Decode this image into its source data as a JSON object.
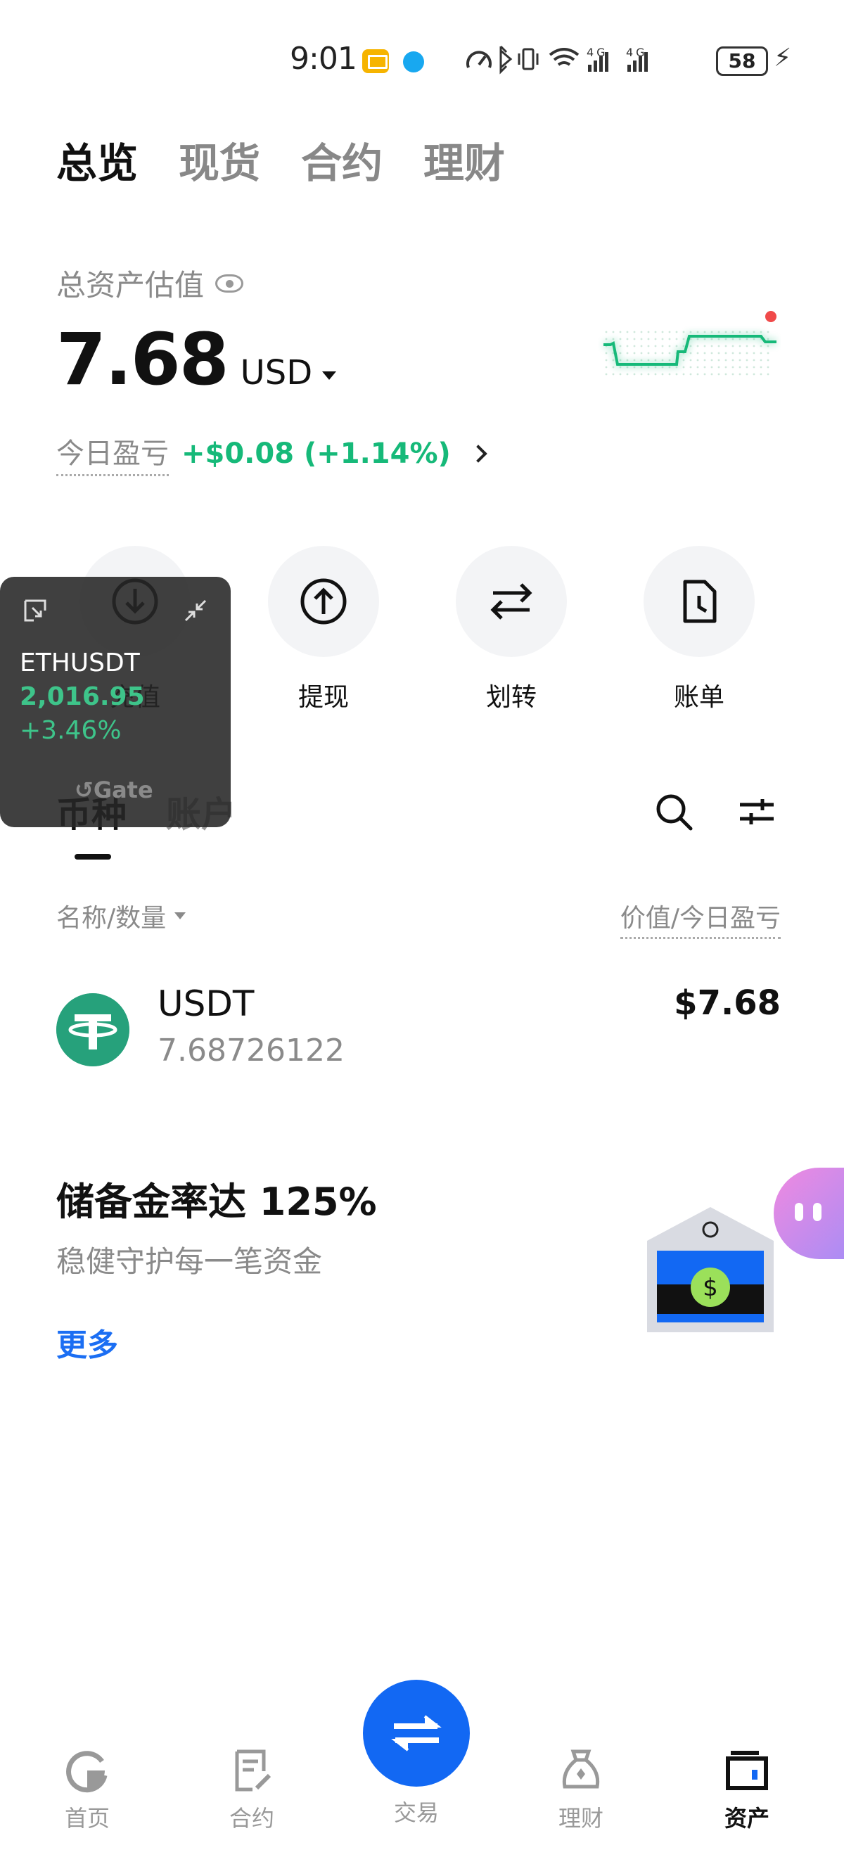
{
  "status_bar": {
    "time": "9:01",
    "battery": "58",
    "signal_text": "4G 4G"
  },
  "top_tabs": [
    "总览",
    "现货",
    "合约",
    "理财"
  ],
  "assets": {
    "label": "总资产估值",
    "amount": "7.68",
    "currency": "USD",
    "pnl_label": "今日盈亏",
    "pnl_value": "+$0.08 (+1.14%)"
  },
  "actions": [
    {
      "label": "充值",
      "icon": "download-icon"
    },
    {
      "label": "提现",
      "icon": "upload-icon"
    },
    {
      "label": "划转",
      "icon": "transfer-icon"
    },
    {
      "label": "账单",
      "icon": "bill-icon"
    }
  ],
  "floating_ticker": {
    "symbol": "ETHUSDT",
    "price": "2,016.95",
    "change": "+3.46%",
    "brand": "Gate"
  },
  "coin_tabs": [
    "币种",
    "账户"
  ],
  "list_header": {
    "left": "名称/数量",
    "right": "价值/今日盈亏"
  },
  "holdings": [
    {
      "name": "USDT",
      "quantity": "7.68726122",
      "value": "$7.68"
    }
  ],
  "reserve": {
    "title": "储备金率达 125%",
    "subtitle": "稳健守护每一笔资金",
    "more": "更多"
  },
  "bottom_nav": [
    {
      "label": "首页",
      "icon": "home-icon"
    },
    {
      "label": "合约",
      "icon": "contract-icon"
    },
    {
      "label": "交易",
      "icon": "trade-icon"
    },
    {
      "label": "理财",
      "icon": "finance-icon"
    },
    {
      "label": "资产",
      "icon": "wallet-icon"
    }
  ],
  "colors": {
    "accent_blue": "#1268f3",
    "profit_green": "#16b979",
    "tether_green": "#26a17b",
    "alert_red": "#f04a4a"
  }
}
